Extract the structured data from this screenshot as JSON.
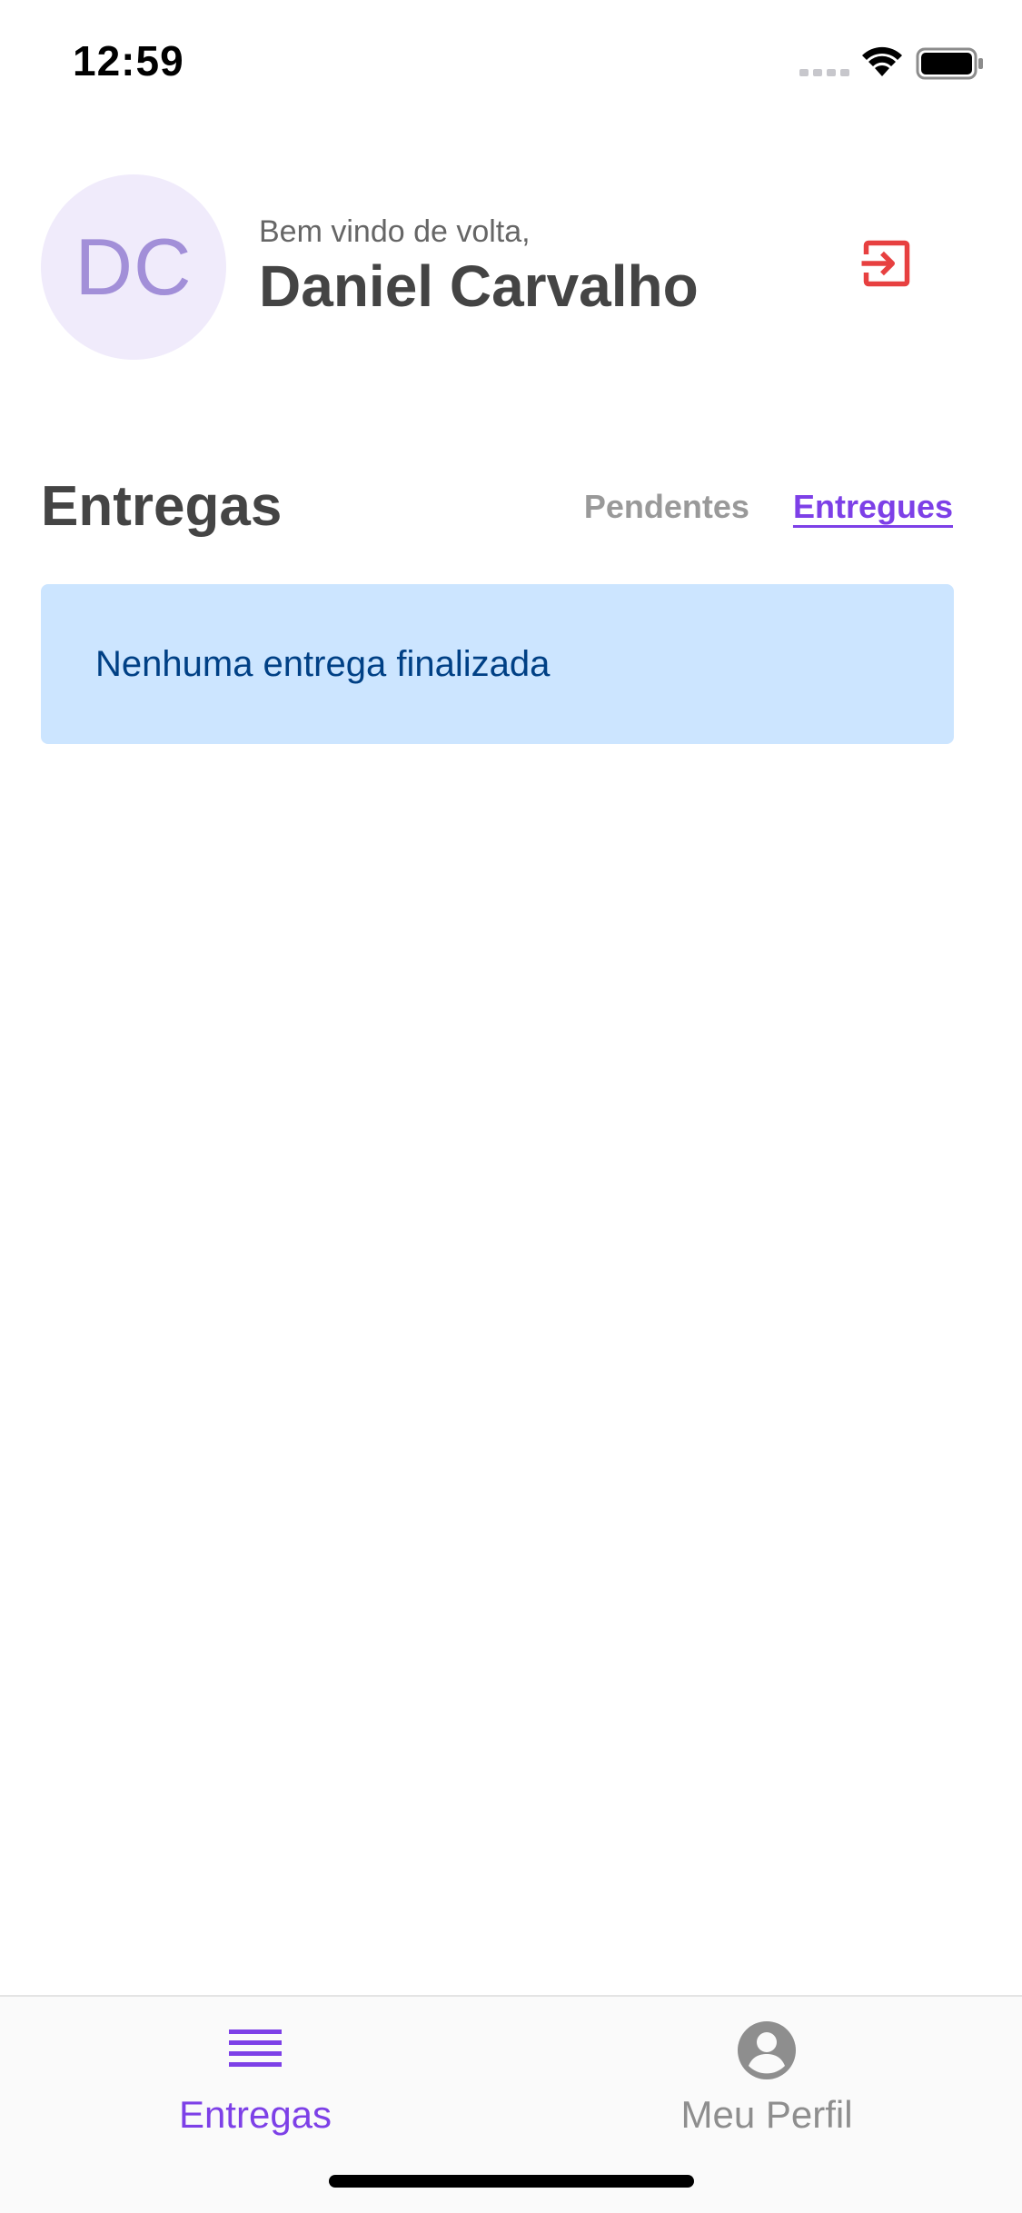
{
  "status_bar": {
    "time": "12:59"
  },
  "header": {
    "avatar_initials": "DC",
    "welcome": "Bem vindo de volta,",
    "user_name": "Daniel Carvalho",
    "logout_icon": "logout-icon"
  },
  "deliveries": {
    "title": "Entregas",
    "tabs": [
      {
        "label": "Pendentes",
        "active": false
      },
      {
        "label": "Entregues",
        "active": true
      }
    ],
    "empty_message": "Nenhuma entrega finalizada"
  },
  "tab_bar": {
    "items": [
      {
        "label": "Entregas",
        "icon": "list-icon",
        "active": true
      },
      {
        "label": "Meu Perfil",
        "icon": "account-circle-icon",
        "active": false
      }
    ]
  },
  "colors": {
    "accent": "#7d40e7",
    "logout": "#e74040",
    "alert_bg": "#cce5ff",
    "alert_text": "#004085",
    "avatar_bg": "#f0ebfb",
    "avatar_text": "#a28fd8"
  }
}
